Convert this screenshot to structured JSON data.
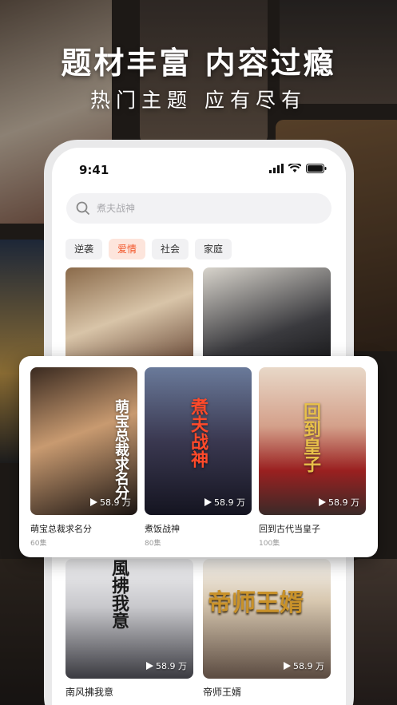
{
  "promo": {
    "headline": "题材丰富  内容过瘾",
    "subline": "热门主题 应有尽有"
  },
  "status_bar": {
    "time": "9:41"
  },
  "search": {
    "placeholder": "煮夫战神"
  },
  "tabs": [
    {
      "label": "逆袭",
      "active": false
    },
    {
      "label": "爱情",
      "active": true
    },
    {
      "label": "社会",
      "active": false
    },
    {
      "label": "家庭",
      "active": false
    }
  ],
  "featured": [
    {
      "title": "萌宝总裁求名分",
      "episodes": "60集",
      "views": "58.9 万",
      "poster_text": "萌宝总裁求名分"
    },
    {
      "title": "煮饭战神",
      "episodes": "80集",
      "views": "58.9 万",
      "poster_text": "煮夫战神"
    },
    {
      "title": "回到古代当皇子",
      "episodes": "100集",
      "views": "58.9 万",
      "poster_text": "回到皇子"
    }
  ],
  "grid_bottom": [
    {
      "title": "南风拂我意",
      "views": "58.9 万",
      "poster_text": "風拂我意"
    },
    {
      "title": "帝师王婿",
      "views": "58.9 万",
      "poster_text": "帝师王婿"
    }
  ],
  "colors": {
    "accent": "#f2572b",
    "tab_active_bg": "#fde5dc"
  }
}
